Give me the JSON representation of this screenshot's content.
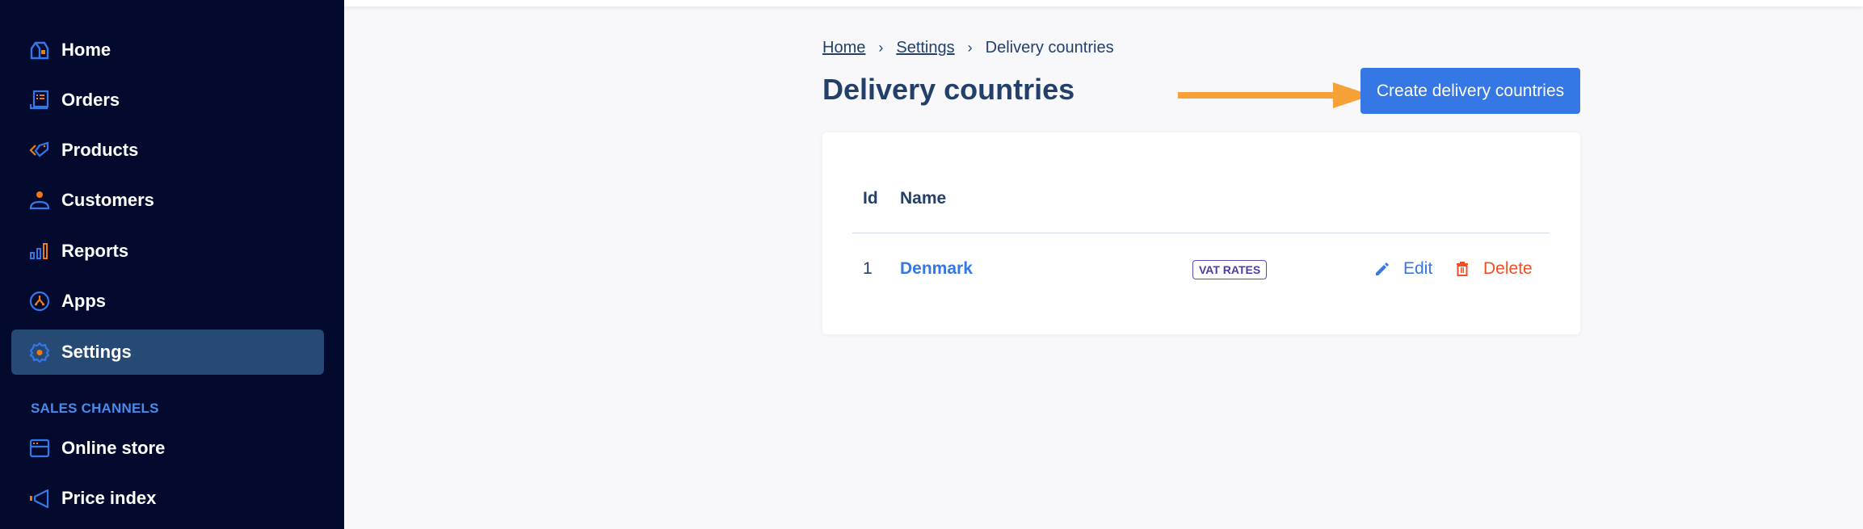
{
  "sidebar": {
    "items": [
      {
        "label": "Home",
        "icon": "home-icon"
      },
      {
        "label": "Orders",
        "icon": "orders-icon"
      },
      {
        "label": "Products",
        "icon": "tag-icon"
      },
      {
        "label": "Customers",
        "icon": "person-icon"
      },
      {
        "label": "Reports",
        "icon": "bar-chart-icon"
      },
      {
        "label": "Apps",
        "icon": "apps-icon"
      },
      {
        "label": "Settings",
        "icon": "gear-icon",
        "active": true
      }
    ],
    "section_label": "SALES CHANNELS",
    "channels": [
      {
        "label": "Online store",
        "icon": "store-icon"
      },
      {
        "label": "Price index",
        "icon": "megaphone-icon"
      }
    ]
  },
  "breadcrumb": {
    "items": [
      "Home",
      "Settings"
    ],
    "current": "Delivery countries"
  },
  "page": {
    "title": "Delivery countries",
    "create_button": "Create delivery countries"
  },
  "table": {
    "headers": [
      "Id",
      "Name"
    ],
    "rows": [
      {
        "id": "1",
        "name": "Denmark",
        "badge": "VAT RATES",
        "edit": "Edit",
        "delete": "Delete"
      }
    ]
  },
  "colors": {
    "sidebar_bg": "#030a2e",
    "active_item": "#264a73",
    "primary": "#3578e5",
    "danger": "#f04e23",
    "accent_orange": "#f7a035",
    "text_dark": "#23406b"
  }
}
